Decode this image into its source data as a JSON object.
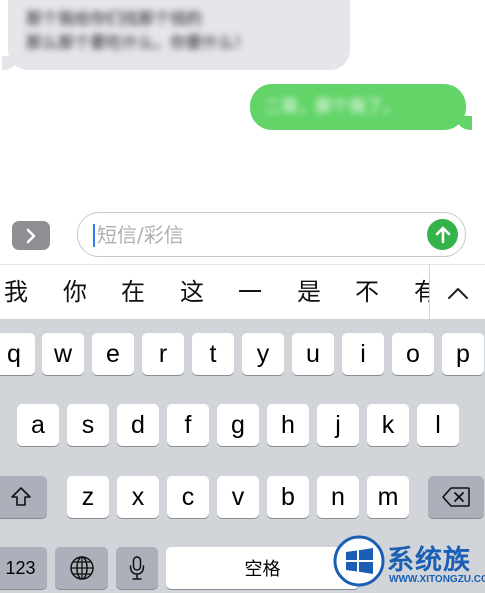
{
  "conversation": {
    "incoming": {
      "line1": "那个我给你们找那个钱的",
      "line2": "那么那个要吃什么，你要什么！"
    },
    "outgoing": {
      "text": "二哥，那个我了。"
    }
  },
  "input_bar": {
    "placeholder": "短信/彩信",
    "expand_icon": "chevron-right-icon",
    "send_icon": "arrow-up-icon",
    "send_color": "#33b34a"
  },
  "candidates": {
    "items": [
      "我",
      "你",
      "在",
      "这",
      "一",
      "是",
      "不"
    ],
    "partial": "有",
    "expand_icon": "chevron-up-icon"
  },
  "keyboard": {
    "row1": [
      "q",
      "w",
      "e",
      "r",
      "t",
      "y",
      "u",
      "i",
      "o",
      "p"
    ],
    "row2": [
      "a",
      "s",
      "d",
      "f",
      "g",
      "h",
      "j",
      "k",
      "l"
    ],
    "row3": [
      "z",
      "x",
      "c",
      "v",
      "b",
      "n",
      "m"
    ],
    "shift_icon": "shift-icon",
    "delete_icon": "delete-icon",
    "numbers_label": "123",
    "globe_icon": "globe-icon",
    "mic_icon": "microphone-icon",
    "space_label": "空格"
  },
  "watermark": {
    "brand": "系统族",
    "url": "WWW.XITONGZU.COM",
    "colors": {
      "primary": "#1a5fb4"
    }
  },
  "colors": {
    "incoming_bubble": "#e5e5ea",
    "outgoing_bubble": "#62d468",
    "keyboard_bg": "#d1d4d9",
    "function_key": "#abb0ba",
    "caret": "#2f7cf6"
  }
}
